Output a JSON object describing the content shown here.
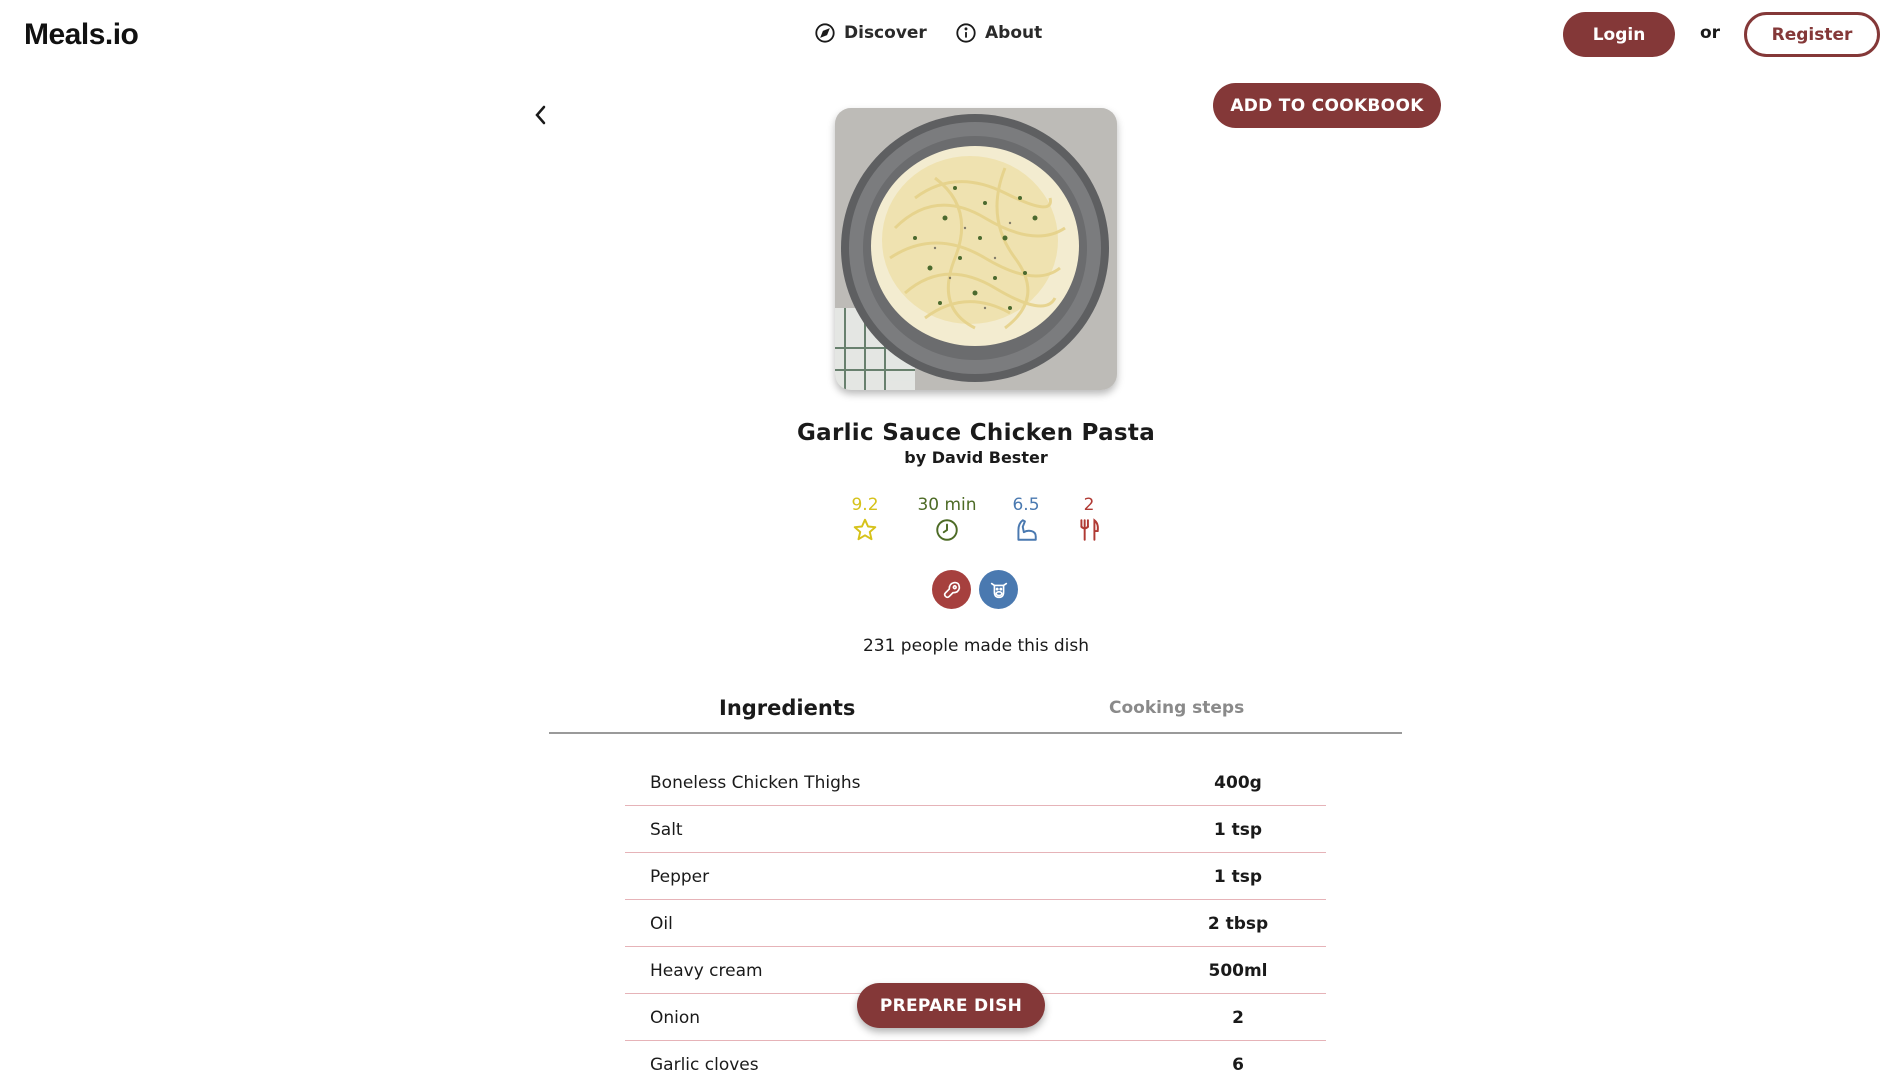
{
  "header": {
    "logo": "Meals.io",
    "nav": [
      {
        "label": "Discover",
        "icon": "compass-icon"
      },
      {
        "label": "About",
        "icon": "info-icon"
      }
    ],
    "login_label": "Login",
    "or_text": "or",
    "register_label": "Register"
  },
  "recipe": {
    "add_to_cookbook_label": "ADD TO COOKBOOK",
    "title": "Garlic Sauce Chicken Pasta",
    "author": "by David Bester",
    "stats": {
      "rating": "9.2",
      "time": "30 min",
      "difficulty": "6.5",
      "servings": "2"
    },
    "tags": [
      "meat-icon",
      "dairy-cow-icon"
    ],
    "made_count_text": "231 people made this dish",
    "tabs": [
      "Ingredients",
      "Cooking steps"
    ],
    "ingredients": [
      {
        "name": "Boneless Chicken Thighs",
        "qty": "400g"
      },
      {
        "name": "Salt",
        "qty": "1 tsp"
      },
      {
        "name": "Pepper",
        "qty": "1 tsp"
      },
      {
        "name": "Oil",
        "qty": "2 tbsp"
      },
      {
        "name": "Heavy cream",
        "qty": "500ml"
      },
      {
        "name": "Onion",
        "qty": "2"
      },
      {
        "name": "Garlic cloves",
        "qty": "6"
      }
    ],
    "prepare_label": "PREPARE DISH"
  },
  "colors": {
    "accent": "#843838",
    "rating": "#d6c21a",
    "time": "#4d6b26",
    "difficulty": "#4a79b0",
    "servings": "#b03a34",
    "divider": "#e6b3b8"
  }
}
